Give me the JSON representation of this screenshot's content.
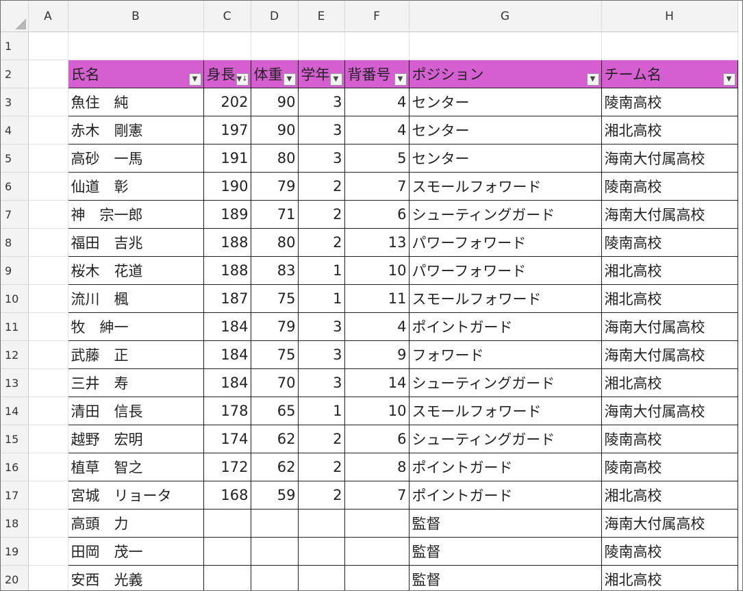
{
  "columns": [
    "A",
    "B",
    "C",
    "D",
    "E",
    "F",
    "G",
    "H"
  ],
  "headers": [
    "氏名",
    "身長",
    "体重",
    "学年",
    "背番号",
    "ポジション",
    "チーム名"
  ],
  "rows": [
    {
      "n": "3",
      "name": "魚住　純",
      "height": "202",
      "weight": "90",
      "grade": "3",
      "number": "4",
      "position": "センター",
      "team": "陵南高校"
    },
    {
      "n": "4",
      "name": "赤木　剛憲",
      "height": "197",
      "weight": "90",
      "grade": "3",
      "number": "4",
      "position": "センター",
      "team": "湘北高校"
    },
    {
      "n": "5",
      "name": "高砂　一馬",
      "height": "191",
      "weight": "80",
      "grade": "3",
      "number": "5",
      "position": "センター",
      "team": "海南大付属高校"
    },
    {
      "n": "6",
      "name": "仙道　彰",
      "height": "190",
      "weight": "79",
      "grade": "2",
      "number": "7",
      "position": "スモールフォワード",
      "team": "陵南高校"
    },
    {
      "n": "7",
      "name": "神　宗一郎",
      "height": "189",
      "weight": "71",
      "grade": "2",
      "number": "6",
      "position": "シューティングガード",
      "team": "海南大付属高校"
    },
    {
      "n": "8",
      "name": "福田　吉兆",
      "height": "188",
      "weight": "80",
      "grade": "2",
      "number": "13",
      "position": "パワーフォワード",
      "team": "陵南高校"
    },
    {
      "n": "9",
      "name": "桜木　花道",
      "height": "188",
      "weight": "83",
      "grade": "1",
      "number": "10",
      "position": "パワーフォワード",
      "team": "湘北高校"
    },
    {
      "n": "10",
      "name": "流川　楓",
      "height": "187",
      "weight": "75",
      "grade": "1",
      "number": "11",
      "position": "スモールフォワード",
      "team": "湘北高校"
    },
    {
      "n": "11",
      "name": "牧　紳一",
      "height": "184",
      "weight": "79",
      "grade": "3",
      "number": "4",
      "position": "ポイントガード",
      "team": "海南大付属高校"
    },
    {
      "n": "12",
      "name": "武藤　正",
      "height": "184",
      "weight": "75",
      "grade": "3",
      "number": "9",
      "position": "フォワード",
      "team": "海南大付属高校"
    },
    {
      "n": "13",
      "name": "三井　寿",
      "height": "184",
      "weight": "70",
      "grade": "3",
      "number": "14",
      "position": "シューティングガード",
      "team": "湘北高校"
    },
    {
      "n": "14",
      "name": "清田　信長",
      "height": "178",
      "weight": "65",
      "grade": "1",
      "number": "10",
      "position": "スモールフォワード",
      "team": "海南大付属高校"
    },
    {
      "n": "15",
      "name": "越野　宏明",
      "height": "174",
      "weight": "62",
      "grade": "2",
      "number": "6",
      "position": "シューティングガード",
      "team": "陵南高校"
    },
    {
      "n": "16",
      "name": "植草　智之",
      "height": "172",
      "weight": "62",
      "grade": "2",
      "number": "8",
      "position": "ポイントガード",
      "team": "陵南高校"
    },
    {
      "n": "17",
      "name": "宮城　リョータ",
      "height": "168",
      "weight": "59",
      "grade": "2",
      "number": "7",
      "position": "ポイントガード",
      "team": "湘北高校"
    },
    {
      "n": "18",
      "name": "高頭　力",
      "height": "",
      "weight": "",
      "grade": "",
      "number": "",
      "position": "監督",
      "team": "海南大付属高校"
    },
    {
      "n": "19",
      "name": "田岡　茂一",
      "height": "",
      "weight": "",
      "grade": "",
      "number": "",
      "position": "監督",
      "team": "陵南高校"
    },
    {
      "n": "20",
      "name": "安西　光義",
      "height": "",
      "weight": "",
      "grade": "",
      "number": "",
      "position": "監督",
      "team": "湘北高校"
    }
  ],
  "icons": {
    "filter": "filter-dropdown-icon",
    "sort_desc": "sort-descending-filter-icon"
  },
  "colors": {
    "header_fill": "#d55fd1",
    "border": "#1f1f1f"
  }
}
